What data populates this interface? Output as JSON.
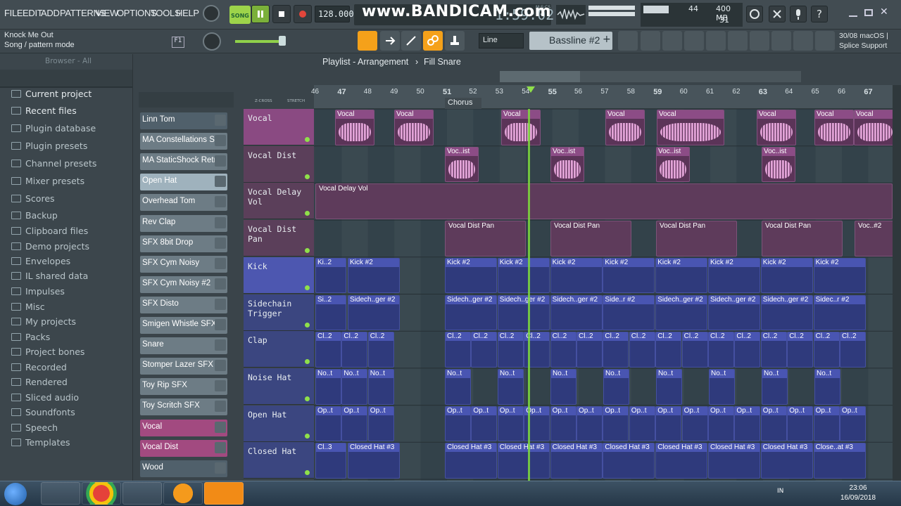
{
  "menu": [
    "FILE",
    "EDIT",
    "ADD",
    "PATTERNS",
    "VIEW",
    "OPTIONS",
    "TOOLS",
    "HELP"
  ],
  "hint": {
    "title": "Knock Me Out",
    "subtitle": "Song / pattern mode"
  },
  "transport": {
    "song_label": "SONG",
    "tempo": "128.000",
    "time": "1:59:02",
    "time_label": "M:S:CS"
  },
  "recording_watermark": "www.BANDICAM.com",
  "cpu": {
    "cpu_value": "44",
    "ram": "400 MB",
    "voices": "31"
  },
  "snap": "Line",
  "pattern": "Bassline #2",
  "news": {
    "date": "30/08",
    "line1": "macOS |",
    "line2": "Splice Support"
  },
  "browser": {
    "header": "Browser - All",
    "items": [
      "Current project",
      "Recent files",
      "Plugin database",
      "Plugin presets",
      "Channel presets",
      "Mixer presets",
      "Scores",
      "Backup",
      "Clipboard files",
      "Demo projects",
      "Envelopes",
      "IL shared data",
      "Impulses",
      "Misc",
      "My projects",
      "Packs",
      "Project bones",
      "Recorded",
      "Rendered",
      "Sliced audio",
      "Soundfonts",
      "Speech",
      "Templates"
    ]
  },
  "channels": [
    "Linn Tom",
    "MA Constellations Sh..",
    "MA StaticShock Retro..",
    "Open Hat",
    "Overhead Tom",
    "Rev Clap",
    "SFX 8bit Drop",
    "SFX Cym Noisy",
    "SFX Cym Noisy #2",
    "SFX Disto",
    "Smigen Whistle SFX",
    "Snare",
    "Stomper Lazer SFX",
    "Toy Rip SFX",
    "Toy Scritch SFX",
    "Vocal",
    "Vocal Dist",
    "Wood"
  ],
  "playlist": {
    "breadcrumb": [
      "Playlist - Arrangement",
      "Fill Snare"
    ],
    "zcross": "Z-CROSS",
    "stretch": "STRETCH",
    "bars": [
      "46",
      "47",
      "48",
      "49",
      "50",
      "51",
      "52",
      "53",
      "54",
      "55",
      "56",
      "57",
      "58",
      "59",
      "60",
      "61",
      "62",
      "63",
      "64",
      "65",
      "66",
      "67"
    ],
    "marker": "Chorus",
    "tracks": [
      "Vocal",
      "Vocal Dist",
      "Vocal Delay Vol",
      "Vocal Dist Pan",
      "Kick",
      "Sidechain Trigger",
      "Clap",
      "Noise Hat",
      "Open Hat",
      "Closed Hat"
    ]
  },
  "clips": {
    "vocal": "Vocal",
    "vocal_dist": "Voc..ist",
    "delay_vol": "Vocal Delay Vol",
    "dist_pan": "Vocal Dist Pan",
    "dist_pan_short": "Voc..#2",
    "kick": "Kick #2",
    "kick_short": "Ki..2",
    "side": "Sidech..ger #2",
    "side_short": "Si..2",
    "side_mid": "Side..r #2",
    "side_end": "Sidec..r #2",
    "clap": "Cl..2",
    "noise": "No..t",
    "openhat": "Op..t",
    "closed": "Closed Hat #3",
    "closed_short": "Cl..3",
    "closed_end": "Close..at #3"
  },
  "taskbar": {
    "lang": "IN",
    "time": "23:06",
    "date": "16/09/2018"
  }
}
